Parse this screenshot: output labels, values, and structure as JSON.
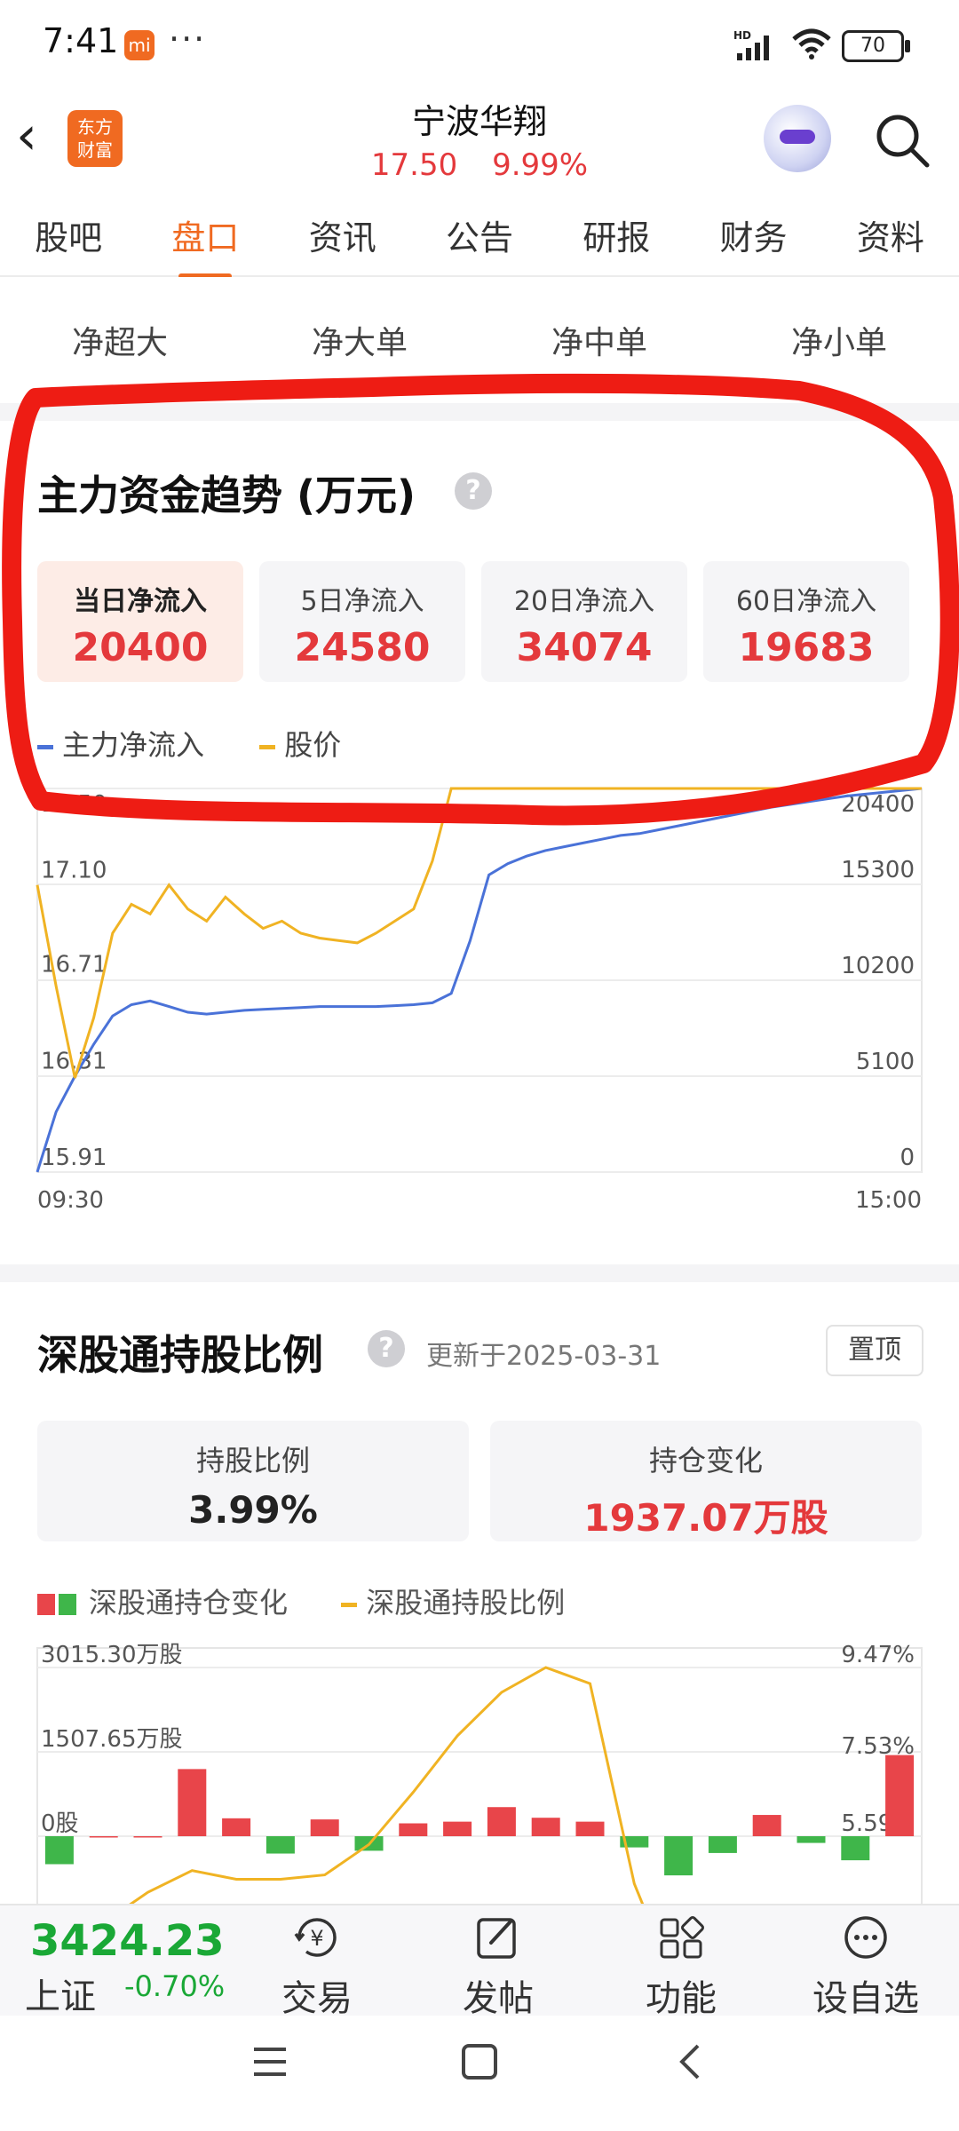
{
  "status_bar": {
    "time": "7:41",
    "mi_badge": "mi",
    "more": "···",
    "battery": "70",
    "network": "HD"
  },
  "header": {
    "name": "宁波华翔",
    "price": "17.50",
    "change_pct": "9.99%",
    "logo_line1": "东方",
    "logo_line2": "财富"
  },
  "tabs": [
    {
      "label": "股吧",
      "active": false
    },
    {
      "label": "盘口",
      "active": true
    },
    {
      "label": "资讯",
      "active": false
    },
    {
      "label": "公告",
      "active": false
    },
    {
      "label": "研报",
      "active": false
    },
    {
      "label": "财务",
      "active": false
    },
    {
      "label": "资料",
      "active": false
    }
  ],
  "subtabs": [
    "净超大",
    "净大单",
    "净中单",
    "净小单"
  ],
  "flow": {
    "title": "主力资金趋势 (万元)",
    "help": "?",
    "stats": [
      {
        "label": "当日净流入",
        "value": "20400",
        "selected": true
      },
      {
        "label": "5日净流入",
        "value": "24580",
        "selected": false
      },
      {
        "label": "20日净流入",
        "value": "34074",
        "selected": false
      },
      {
        "label": "60日净流入",
        "value": "19683",
        "selected": false
      }
    ],
    "legend": {
      "main": "主力净流入",
      "price": "股价"
    },
    "colors": {
      "main": "#4a72d8",
      "price": "#f0b323"
    }
  },
  "chart_data": [
    {
      "type": "line",
      "x_labels": [
        "09:30",
        "15:00"
      ],
      "y_left_ticks": [
        "16.31",
        "16.71",
        "17.10",
        "15.91",
        "17.50"
      ],
      "y_right_ticks": [
        "20400",
        "15300",
        "10200",
        "5100",
        "0"
      ],
      "y_left_range": [
        15.91,
        17.5
      ],
      "y_right_range": [
        0,
        20400
      ],
      "series": [
        {
          "name": "主力净流入",
          "axis": "right",
          "color": "#4a72d8",
          "values": [
            0,
            3200,
            5100,
            6800,
            8300,
            8900,
            9100,
            8800,
            8500,
            8400,
            8500,
            8600,
            8650,
            8700,
            8750,
            8800,
            8800,
            8800,
            8800,
            8850,
            8900,
            9000,
            9500,
            12300,
            15800,
            16400,
            16800,
            17100,
            17300,
            17500,
            17700,
            17900,
            18000,
            18200,
            18400,
            18600,
            18800,
            19000,
            19200,
            19400,
            19550,
            19700,
            19850,
            20000,
            20100,
            20200,
            20300,
            20400
          ]
        },
        {
          "name": "股价",
          "axis": "left",
          "color": "#f0b323",
          "values": [
            17.1,
            16.68,
            16.3,
            16.55,
            16.9,
            17.02,
            16.98,
            17.1,
            17.0,
            16.95,
            17.05,
            16.98,
            16.92,
            16.95,
            16.9,
            16.88,
            16.87,
            16.86,
            16.9,
            16.95,
            17.0,
            17.2,
            17.5,
            17.5,
            17.5,
            17.5,
            17.5,
            17.5,
            17.5,
            17.5,
            17.5,
            17.5,
            17.5,
            17.5,
            17.5,
            17.5,
            17.5,
            17.5,
            17.5,
            17.5,
            17.5,
            17.5,
            17.5,
            17.5,
            17.5,
            17.5,
            17.5,
            17.5
          ]
        }
      ]
    },
    {
      "type": "bar",
      "y_left_ticks": [
        "3015.30万股",
        "1507.65万股",
        "0股"
      ],
      "y_right_ticks": [
        "9.47%",
        "7.53%",
        "5.59%"
      ],
      "y_left_range": [
        -3015.3,
        3015.3
      ],
      "y_right_range": [
        3.65,
        9.47
      ],
      "bar_values": [
        -500,
        0,
        0,
        1200,
        320,
        -310,
        300,
        -260,
        230,
        260,
        520,
        330,
        260,
        -200,
        -700,
        -300,
        380,
        -120,
        -430,
        1450
      ],
      "line_name": "深股通持股比例",
      "line_values": [
        2.8,
        3.6,
        4.3,
        4.8,
        4.6,
        4.6,
        4.7,
        5.4,
        6.6,
        7.9,
        8.9,
        9.47,
        9.1,
        4.5,
        2.0,
        1.5,
        1.4,
        1.4,
        1.5,
        1.6
      ]
    }
  ],
  "sz": {
    "title": "深股通持股比例",
    "help": "?",
    "updated": "更新于2025-03-31",
    "pin": "置顶",
    "hold_ratio_label": "持股比例",
    "hold_ratio_value": "3.99%",
    "position_change_label": "持仓变化",
    "position_change_value": "1937.07万股",
    "legend_bar": "深股通持仓变化",
    "legend_line": "深股通持股比例",
    "colors": {
      "up": "#e8454a",
      "down": "#3fb64a",
      "line": "#f0b323"
    }
  },
  "bottom_bar": {
    "index_value": "3424.23",
    "index_name": "上证",
    "index_change": "-0.70%",
    "items": [
      {
        "label": "交易",
        "icon": "yen-icon"
      },
      {
        "label": "发帖",
        "icon": "edit-icon"
      },
      {
        "label": "功能",
        "icon": "grid-icon"
      },
      {
        "label": "设自选",
        "icon": "more-icon"
      }
    ]
  }
}
